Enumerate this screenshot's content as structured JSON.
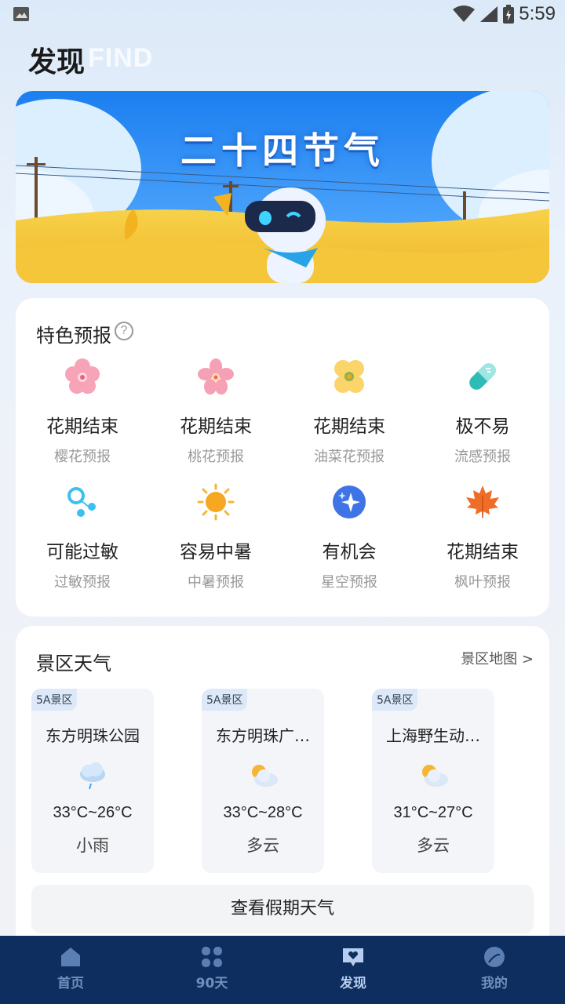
{
  "status_bar": {
    "time": "5:59"
  },
  "header": {
    "title": "发现",
    "title_en": "FIND"
  },
  "banner": {
    "title": "二十四节气"
  },
  "features": {
    "title": "特色预报",
    "help_symbol": "?",
    "items": [
      {
        "value": "花期结束",
        "label": "樱花预报",
        "icon": "cherry-blossom-icon"
      },
      {
        "value": "花期结束",
        "label": "桃花预报",
        "icon": "peach-blossom-icon"
      },
      {
        "value": "花期结束",
        "label": "油菜花预报",
        "icon": "rapeseed-flower-icon"
      },
      {
        "value": "极不易",
        "label": "流感预报",
        "icon": "capsule-icon"
      },
      {
        "value": "可能过敏",
        "label": "过敏预报",
        "icon": "pollen-icon"
      },
      {
        "value": "容易中暑",
        "label": "中暑预报",
        "icon": "sun-icon"
      },
      {
        "value": "有机会",
        "label": "星空预报",
        "icon": "stars-icon"
      },
      {
        "value": "花期结束",
        "label": "枫叶预报",
        "icon": "maple-leaf-icon"
      }
    ]
  },
  "scenic": {
    "title": "景区天气",
    "map_link": "景区地图 >",
    "spots": [
      {
        "badge": "5A景区",
        "name": "东方明珠公园",
        "temp": "33°C~26°C",
        "condition": "小雨",
        "icon": "light-rain-icon"
      },
      {
        "badge": "5A景区",
        "name": "东方明珠广…",
        "temp": "33°C~28°C",
        "condition": "多云",
        "icon": "partly-cloudy-icon"
      },
      {
        "badge": "5A景区",
        "name": "上海野生动…",
        "temp": "31°C~27°C",
        "condition": "多云",
        "icon": "partly-cloudy-icon"
      }
    ],
    "holiday_button": "查看假期天气"
  },
  "nav": [
    {
      "label": "首页",
      "icon": "home-icon"
    },
    {
      "label": "90天",
      "icon": "grid-icon"
    },
    {
      "label": "发现",
      "icon": "discover-icon"
    },
    {
      "label": "我的",
      "icon": "profile-icon"
    }
  ]
}
